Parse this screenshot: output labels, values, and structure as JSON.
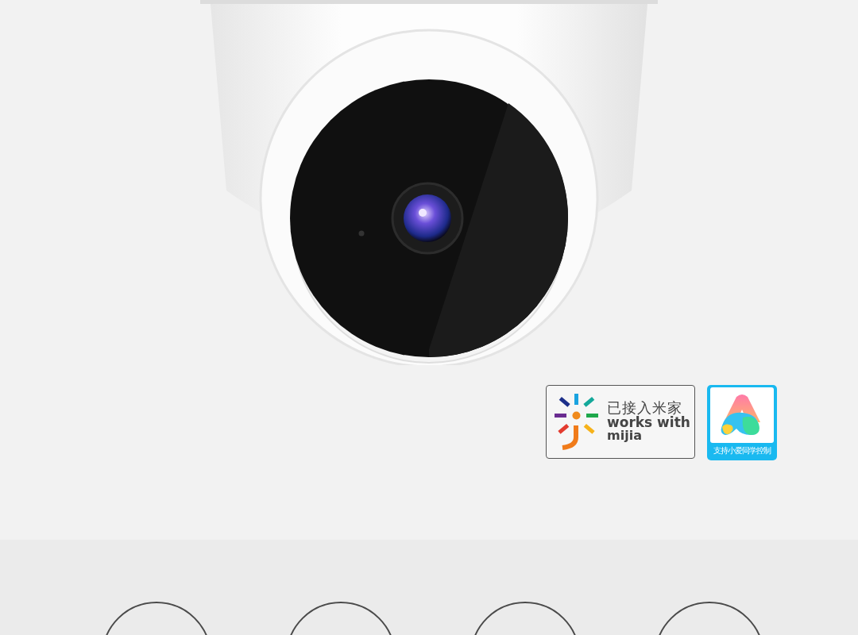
{
  "badges": [
    {
      "kind": "mijia",
      "title": "已接入米家",
      "subtitle": "works with",
      "brand": "mijia"
    },
    {
      "kind": "xiaoai",
      "caption": "支持小爱同学控制"
    }
  ]
}
